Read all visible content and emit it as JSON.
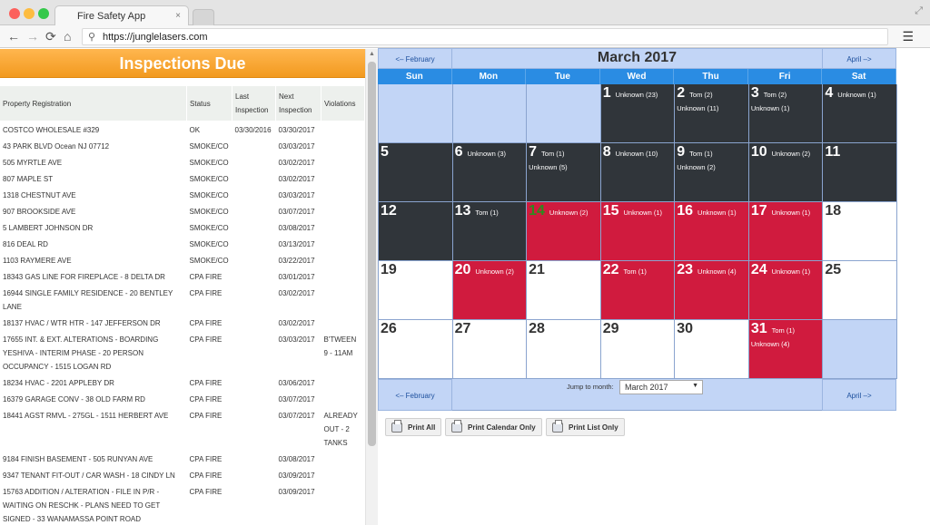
{
  "browser": {
    "tab_title": "Fire Safety App",
    "tab_close": "×",
    "url": "https://junglelasers.com",
    "icons": {
      "back": "←",
      "forward": "→",
      "reload": "⟳",
      "home": "⌂",
      "search": "⚲",
      "menu": "☰",
      "resize": "⤢"
    },
    "dot_colors": [
      "#fc605c",
      "#fdbc40",
      "#34c84a"
    ]
  },
  "inspections": {
    "title": "Inspections Due",
    "columns": [
      "Property Registration",
      "Status",
      "Last Inspection",
      "Next Inspection",
      "Violations"
    ],
    "rows": [
      [
        "COSTCO WHOLESALE #329",
        "OK",
        "03/30/2016",
        "03/30/2017",
        ""
      ],
      [
        "43 PARK BLVD Ocean NJ 07712",
        "SMOKE/CO",
        "",
        "03/03/2017",
        ""
      ],
      [
        "505 MYRTLE AVE",
        "SMOKE/CO",
        "",
        "03/02/2017",
        ""
      ],
      [
        "807 MAPLE ST",
        "SMOKE/CO",
        "",
        "03/02/2017",
        ""
      ],
      [
        "1318 CHESTNUT AVE",
        "SMOKE/CO",
        "",
        "03/03/2017",
        ""
      ],
      [
        "907 BROOKSIDE AVE",
        "SMOKE/CO",
        "",
        "03/07/2017",
        ""
      ],
      [
        "5 LAMBERT JOHNSON DR",
        "SMOKE/CO",
        "",
        "03/08/2017",
        ""
      ],
      [
        "816 DEAL RD",
        "SMOKE/CO",
        "",
        "03/13/2017",
        ""
      ],
      [
        "1103 RAYMERE AVE",
        "SMOKE/CO",
        "",
        "03/22/2017",
        ""
      ],
      [
        "18343 GAS LINE FOR FIREPLACE - 8 DELTA DR",
        "CPA FIRE",
        "",
        "03/01/2017",
        ""
      ],
      [
        "16944 SINGLE FAMILY RESIDENCE - 20 BENTLEY LANE",
        "CPA FIRE",
        "",
        "03/02/2017",
        ""
      ],
      [
        "18137 HVAC / WTR HTR - 147 JEFFERSON DR",
        "CPA FIRE",
        "",
        "03/02/2017",
        ""
      ],
      [
        "17655 INT. & EXT. ALTERATIONS - BOARDING YESHIVA - INTERIM PHASE - 20 PERSON OCCUPANCY - 1515 LOGAN RD",
        "CPA FIRE",
        "",
        "03/03/2017",
        "B'TWEEN 9 - 11AM"
      ],
      [
        "18234 HVAC - 2201 APPLEBY DR",
        "CPA FIRE",
        "",
        "03/06/2017",
        ""
      ],
      [
        "16379 GARAGE CONV - 38 OLD FARM RD",
        "CPA FIRE",
        "",
        "03/07/2017",
        ""
      ],
      [
        "18441 AGST RMVL - 275GL - 1511 HERBERT AVE",
        "CPA FIRE",
        "",
        "03/07/2017",
        "ALREADY OUT - 2 TANKS"
      ],
      [
        "9184 FINISH BASEMENT - 505 RUNYAN AVE",
        "CPA FIRE",
        "",
        "03/08/2017",
        ""
      ],
      [
        "9347 TENANT FIT-OUT / CAR WASH - 18 CINDY LN",
        "CPA FIRE",
        "",
        "03/09/2017",
        ""
      ],
      [
        "15763 ADDITION / ALTERATION - FILE IN P/R - WAITING ON RESCHK - PLANS NEED TO GET SIGNED - 33 WANAMASSA POINT ROAD",
        "CPA FIRE",
        "",
        "03/09/2017",
        ""
      ]
    ]
  },
  "calendar": {
    "title": "March 2017",
    "prev_label": "<– February",
    "next_label": "April –>",
    "days_of_week": [
      "Sun",
      "Mon",
      "Tue",
      "Wed",
      "Thu",
      "Fri",
      "Sat"
    ],
    "jump_label": "Jump to month:",
    "jump_value": "March 2017",
    "colors": {
      "past": "#30353a",
      "due": "#d01b3e",
      "empty": "#c2d5f6",
      "header": "#2a8ce3"
    },
    "cells": [
      {
        "day": "",
        "state": "empty",
        "events": []
      },
      {
        "day": "",
        "state": "empty",
        "events": []
      },
      {
        "day": "",
        "state": "empty",
        "events": []
      },
      {
        "day": "1",
        "state": "past",
        "events": [
          "Unknown (23)"
        ]
      },
      {
        "day": "2",
        "state": "past",
        "events": [
          "Tom (2)",
          "Unknown (11)"
        ]
      },
      {
        "day": "3",
        "state": "past",
        "events": [
          "Tom (2)",
          "Unknown (1)"
        ]
      },
      {
        "day": "4",
        "state": "past",
        "events": [
          "Unknown (1)"
        ]
      },
      {
        "day": "5",
        "state": "past",
        "events": []
      },
      {
        "day": "6",
        "state": "past",
        "events": [
          "Unknown (3)"
        ]
      },
      {
        "day": "7",
        "state": "past",
        "events": [
          "Tom (1)",
          "Unknown (5)"
        ]
      },
      {
        "day": "8",
        "state": "past",
        "events": [
          "Unknown (10)"
        ]
      },
      {
        "day": "9",
        "state": "past",
        "events": [
          "Tom (1)",
          "Unknown (2)"
        ]
      },
      {
        "day": "10",
        "state": "past",
        "events": [
          "Unknown (2)"
        ]
      },
      {
        "day": "11",
        "state": "past",
        "events": []
      },
      {
        "day": "12",
        "state": "past",
        "events": []
      },
      {
        "day": "13",
        "state": "past",
        "events": [
          "Tom (1)"
        ]
      },
      {
        "day": "14",
        "state": "due",
        "today": true,
        "events": [
          "Unknown (2)"
        ]
      },
      {
        "day": "15",
        "state": "due",
        "events": [
          "Unknown (1)"
        ]
      },
      {
        "day": "16",
        "state": "due",
        "events": [
          "Unknown (1)"
        ]
      },
      {
        "day": "17",
        "state": "due",
        "events": [
          "Unknown (1)"
        ]
      },
      {
        "day": "18",
        "state": "future",
        "events": []
      },
      {
        "day": "19",
        "state": "future",
        "events": []
      },
      {
        "day": "20",
        "state": "due",
        "events": [
          "Unknown (2)"
        ]
      },
      {
        "day": "21",
        "state": "future",
        "events": []
      },
      {
        "day": "22",
        "state": "due",
        "events": [
          "Tom (1)"
        ]
      },
      {
        "day": "23",
        "state": "due",
        "events": [
          "Unknown (4)"
        ]
      },
      {
        "day": "24",
        "state": "due",
        "events": [
          "Unknown (1)"
        ]
      },
      {
        "day": "25",
        "state": "future",
        "events": []
      },
      {
        "day": "26",
        "state": "future",
        "events": []
      },
      {
        "day": "27",
        "state": "future",
        "events": []
      },
      {
        "day": "28",
        "state": "future",
        "events": []
      },
      {
        "day": "29",
        "state": "future",
        "events": []
      },
      {
        "day": "30",
        "state": "future",
        "events": []
      },
      {
        "day": "31",
        "state": "due",
        "events": [
          "Tom (1)",
          "Unknown (4)"
        ]
      },
      {
        "day": "",
        "state": "empty",
        "events": []
      }
    ]
  },
  "actions": {
    "print_all": "Print All",
    "print_calendar": "Print Calendar Only",
    "print_list": "Print List Only"
  }
}
